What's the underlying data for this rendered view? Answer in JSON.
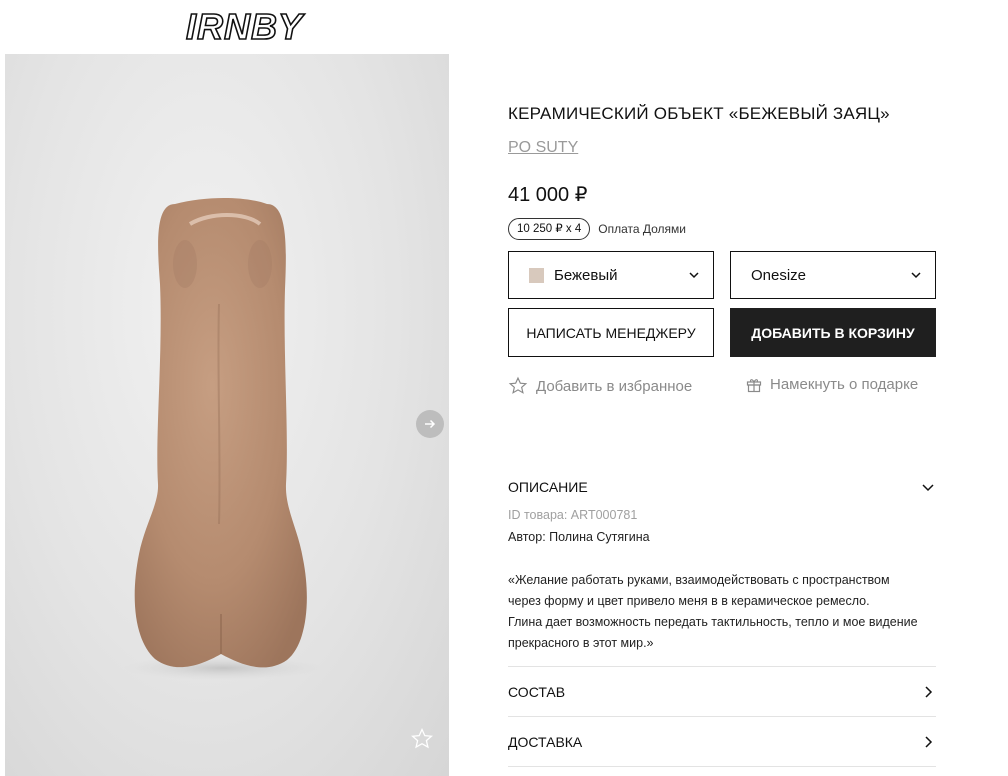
{
  "logo": "IRNBY",
  "product": {
    "title": "КЕРАМИЧЕСКИЙ ОБЪЕКТ «БЕЖЕВЫЙ ЗАЯЦ»",
    "brand": "PO SUTY",
    "price": "41 000 ₽",
    "split_badge": "10 250 ₽ х 4",
    "split_label": "Оплата Долями"
  },
  "selectors": {
    "color": {
      "value": "Бежевый",
      "swatch": "#d8c9bd"
    },
    "size": {
      "value": "Onesize"
    }
  },
  "buttons": {
    "manager": "НАПИСАТЬ МЕНЕДЖЕРУ",
    "cart": "ДОБАВИТЬ В КОРЗИНУ"
  },
  "links": {
    "favorite": "Добавить в избранное",
    "gift": "Намекнуть о подарке"
  },
  "accordion": {
    "description": {
      "label": "ОПИСАНИЕ",
      "id_line": "ID товара: ART000781",
      "author_line": "Автор: Полина Сутягина",
      "text_lines": [
        "«Желание работать руками, взаимодействовать с пространством",
        "через форму и цвет привело меня в в керамическое ремесло.",
        "Глина дает возможность передать тактильность, тепло и мое видение",
        "прекрасного в этот мир.»"
      ]
    },
    "composition": {
      "label": "СОСТАВ"
    },
    "delivery": {
      "label": "ДОСТАВКА"
    }
  },
  "icons": {
    "next": "arrow-right-icon",
    "photo_favorite": "star-outline-icon",
    "favorite": "star-outline-icon",
    "gift": "gift-icon",
    "expand": "chevron-down-icon",
    "open": "chevron-right-icon"
  },
  "colors": {
    "accent_dark": "#1f1f1f",
    "muted_text": "#8a8a8a",
    "ceramic": "#b98f73"
  }
}
